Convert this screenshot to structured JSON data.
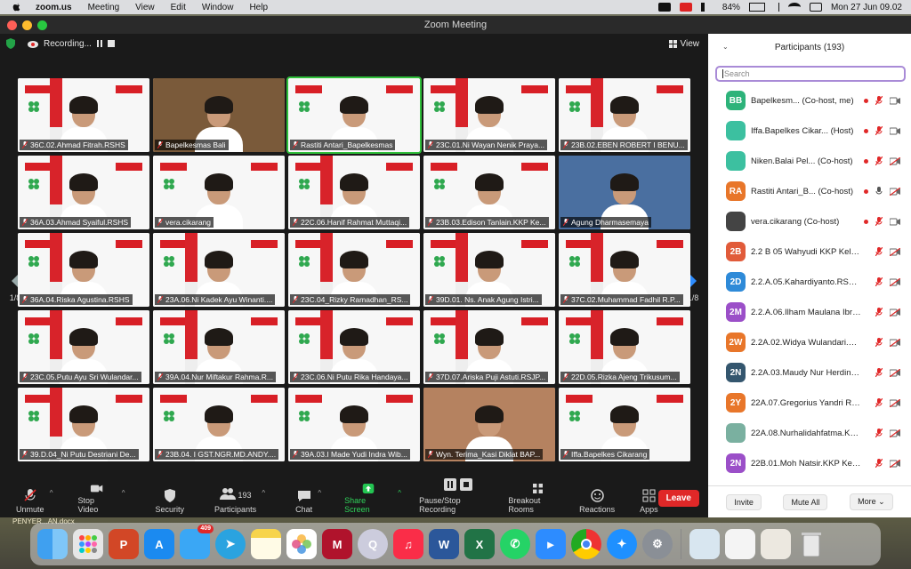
{
  "menubar": {
    "app": "zoom.us",
    "items": [
      "Meeting",
      "View",
      "Edit",
      "Window",
      "Help"
    ],
    "battery": "84%",
    "datetime": "Mon 27 Jun  09.02"
  },
  "window": {
    "title": "Zoom Meeting"
  },
  "topbar": {
    "recording": "Recording...",
    "view": "View"
  },
  "pagination": {
    "left": "1/8",
    "right": "1/8"
  },
  "tiles": [
    {
      "name": "36C.02.Ahmad Fitrah.RSHS"
    },
    {
      "name": "Bapelkesmas Bali"
    },
    {
      "name": "Rastiti Antari_Bapelkesmas"
    },
    {
      "name": "23C.01.Ni Wayan Nenik Praya..."
    },
    {
      "name": "23B.02.EBEN ROBERT I BENU..."
    },
    {
      "name": "36A.03.Ahmad Syaiful.RSHS"
    },
    {
      "name": "vera.cikarang"
    },
    {
      "name": "22C.06.Hanif Rahmat Muttaqi..."
    },
    {
      "name": "23B.03.Edison Tanlain.KKP Ke..."
    },
    {
      "name": "Agung Dharmasemaya"
    },
    {
      "name": "36A.04.Riska Agustina.RSHS"
    },
    {
      "name": "23A.06.Ni Kadek Ayu Winanti...."
    },
    {
      "name": "23C.04_Rizky Ramadhan_RS..."
    },
    {
      "name": "39D.01. Ns. Anak Agung Istri..."
    },
    {
      "name": "37C.02.Muhammad Fadhil R.P..."
    },
    {
      "name": "23C.05.Putu Ayu Sri Wulandar..."
    },
    {
      "name": "39A.04.Nur Miftakur Rahma.R..."
    },
    {
      "name": "23C.06.Ni Putu Rika Handaya..."
    },
    {
      "name": "37D.07.Ariska Puji Astuti.RSJP..."
    },
    {
      "name": "22D.05.Rizka Ajeng Trikusum..."
    },
    {
      "name": "39.D.04_Ni Putu Destriani De..."
    },
    {
      "name": "23B.04. I GST.NGR.MD.ANDY...."
    },
    {
      "name": "39A.03.I Made Yudi Indra Wib..."
    },
    {
      "name": "Wyn. Terima_Kasi Diklat  BAP..."
    },
    {
      "name": "Iffa.Bapelkes Cikarang"
    }
  ],
  "toolbar": {
    "unmute": "Unmute",
    "stop_video": "Stop Video",
    "security": "Security",
    "participants": "Participants",
    "participants_count": "193",
    "chat": "Chat",
    "share": "Share Screen",
    "pause": "Pause/Stop Recording",
    "breakout": "Breakout Rooms",
    "reactions": "Reactions",
    "apps": "Apps",
    "leave": "Leave"
  },
  "panel": {
    "title": "Participants (193)",
    "search_placeholder": "Search",
    "participants": [
      {
        "initials": "BB",
        "name": "Bapelkesm...  (Co-host, me)",
        "color": "#2db37a"
      },
      {
        "initials": "",
        "name": "Iffa.Bapelkes Cikar...  (Host)",
        "color": "#3cc0a0"
      },
      {
        "initials": "",
        "name": "Niken.Balai Pel...  (Co-host)",
        "color": "#3cc0a0"
      },
      {
        "initials": "RA",
        "name": "Rastiti Antari_B...  (Co-host)",
        "color": "#e8762a"
      },
      {
        "initials": "",
        "name": "vera.cikarang  (Co-host)",
        "color": "#444"
      },
      {
        "initials": "2B",
        "name": "2.2 B 05 Wahyudi KKP Kelas...",
        "color": "#e15b3a"
      },
      {
        "initials": "2D",
        "name": "2.2.A.05.Kahardiyanto.RSUP...",
        "color": "#2e8ad8"
      },
      {
        "initials": "2M",
        "name": "2.2.A.06.Ilham Maulana Ibrah...",
        "color": "#9b4fc8"
      },
      {
        "initials": "2W",
        "name": "2.2A.02.Widya Wulandari.RS...",
        "color": "#e8762a"
      },
      {
        "initials": "2N",
        "name": "2.2A.03.Maudy Nur Herdini....",
        "color": "#34566e"
      },
      {
        "initials": "2Y",
        "name": "22A.07.Gregorius Yandri R.K...",
        "color": "#e8762a"
      },
      {
        "initials": "",
        "name": "22A.08.Nurhalidahfatma.KK...",
        "color": "#7ab0a0"
      },
      {
        "initials": "2N",
        "name": "22B.01.Moh Natsir.KKP Kelas...",
        "color": "#9b4fc8"
      }
    ],
    "invite": "Invite",
    "mute_all": "Mute All",
    "more": "More"
  },
  "desktop": {
    "file": "PENYER...AN.docx"
  },
  "dock": {
    "mail_badge": "409"
  }
}
